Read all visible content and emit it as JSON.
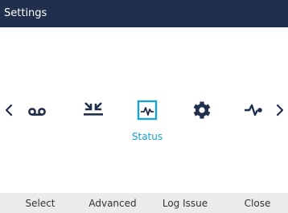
{
  "header": {
    "title": "Settings"
  },
  "menu": {
    "items": [
      {
        "icon": "voicemail-icon"
      },
      {
        "icon": "call-log-icon"
      },
      {
        "icon": "status-icon",
        "selected": true,
        "label": "Status"
      },
      {
        "icon": "gear-icon"
      },
      {
        "icon": "diagnostics-icon"
      }
    ],
    "selected_label": "Status"
  },
  "softkeys": {
    "select": "Select",
    "advanced": "Advanced",
    "log_issue": "Log Issue",
    "close": "Close"
  },
  "colors": {
    "header_bg": "#1f2f4c",
    "accent": "#1aa2cf",
    "icon": "#1f2f4c",
    "softkey_bg": "#ebebeb"
  }
}
